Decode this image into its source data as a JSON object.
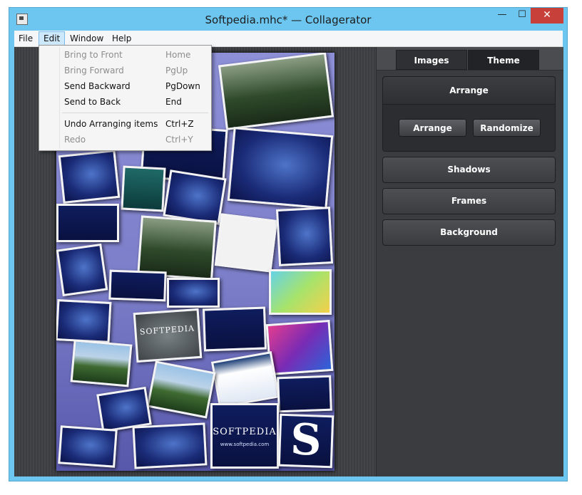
{
  "window": {
    "title": "Softpedia.mhc* — Collagerator",
    "min_glyph": "—",
    "max_glyph": "☐",
    "close_glyph": "✕"
  },
  "menubar": {
    "items": [
      "File",
      "Edit",
      "Window",
      "Help"
    ],
    "active": "Edit"
  },
  "edit_menu": {
    "items": [
      {
        "label": "Bring to Front",
        "shortcut": "Home",
        "enabled": false
      },
      {
        "label": "Bring Forward",
        "shortcut": "PgUp",
        "enabled": false
      },
      {
        "label": "Send Backward",
        "shortcut": "PgDown",
        "enabled": true
      },
      {
        "label": "Send to Back",
        "shortcut": "End",
        "enabled": true
      },
      {
        "label": "Undo Arranging items",
        "shortcut": "Ctrl+Z",
        "enabled": true
      },
      {
        "label": "Redo",
        "shortcut": "Ctrl+Y",
        "enabled": false
      }
    ]
  },
  "panel": {
    "tabs": [
      "Images",
      "Theme"
    ],
    "active_tab": "Theme",
    "arrange": {
      "title": "Arrange",
      "buttons": [
        "Arrange",
        "Randomize"
      ]
    },
    "sections": [
      "Shadows",
      "Frames",
      "Background"
    ]
  },
  "collage": {
    "logo_text": "S",
    "caption_softpedia": "SOFTPEDIA",
    "caption_url": "www.softpedia.com"
  },
  "colors": {
    "titlebar": "#6cc6ef",
    "close_button": "#c7413a",
    "panel_bg": "#3a3c40"
  }
}
